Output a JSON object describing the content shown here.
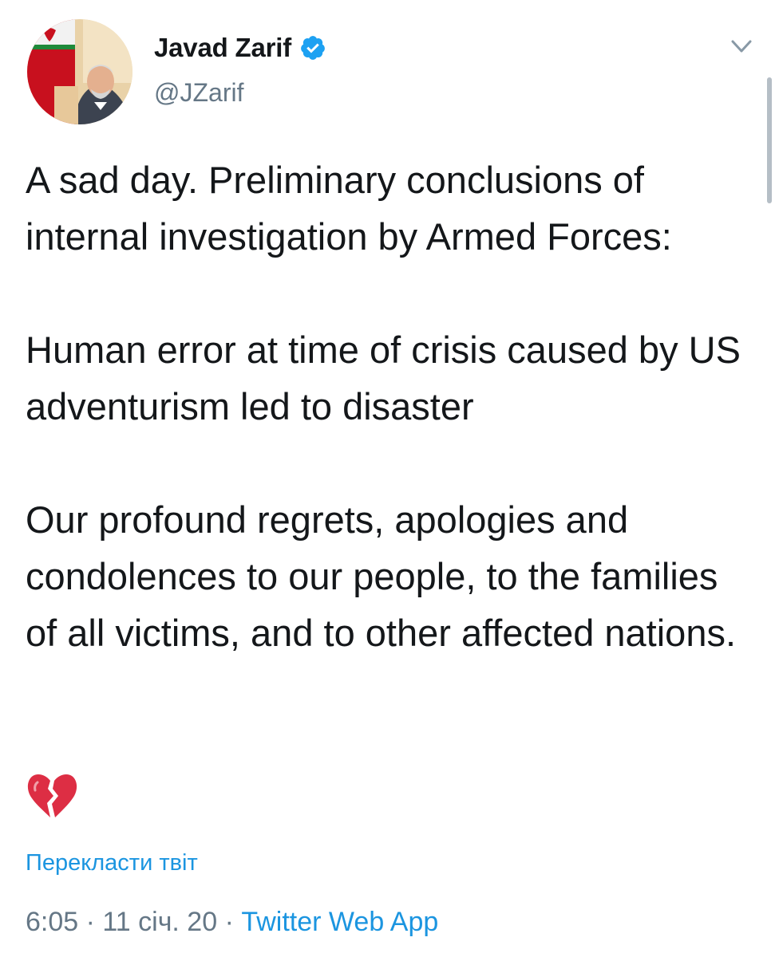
{
  "author": {
    "display_name": "Javad Zarif",
    "handle": "@JZarif",
    "verified": true
  },
  "icons": {
    "verified": "verified-badge-icon",
    "menu": "chevron-down-icon",
    "emoji": "broken-heart"
  },
  "tweet": {
    "paragraphs": [
      "A sad day. Preliminary conclusions of internal investigation by Armed Forces:",
      "Human error at time of crisis caused by US adventurism led to disaster",
      "Our profound regrets, apologies and condolences to our people, to the families of all victims, and to other affected nations."
    ],
    "emoji": "💔"
  },
  "translate_label": "Перекласти твіт",
  "meta": {
    "time": "6:05",
    "separator": " · ",
    "date": "11 січ. 20",
    "source": "Twitter Web App"
  },
  "colors": {
    "link": "#1b95e0",
    "secondary_text": "#657786",
    "primary_text": "#14171a",
    "verified_badge": "#1da1f2"
  }
}
